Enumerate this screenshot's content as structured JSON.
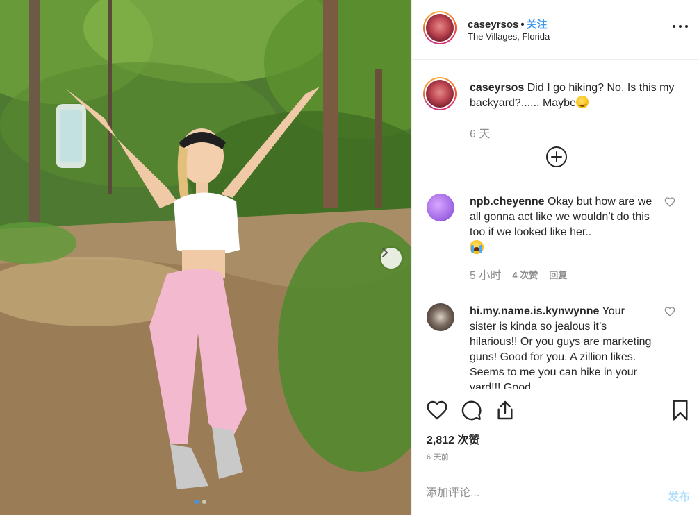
{
  "post": {
    "username": "caseyrsos",
    "follow_label": "关注",
    "location": "The Villages, Florida",
    "caption": {
      "username": "caseyrsos",
      "text": "Did I go hiking? No. Is this my backyard?...... Maybe",
      "emoji": "smiling-face-emoji",
      "time": "6 天"
    },
    "comments": [
      {
        "username": "npb.cheyenne",
        "text": "Okay but how are we all gonna act like we wouldn’t do this too if we looked like her..",
        "emoji": "loudly-crying-face-emoji",
        "time": "5 小时",
        "likes": "4 次赞",
        "reply": "回复"
      },
      {
        "username": "hi.my.name.is.kynwynne",
        "text": "Your sister is kinda so jealous it’s hilarious!! Or you guys are marketing guns! Good for you. A zillion likes. Seems to me you can hike in your yard!!! Good",
        "time": "",
        "likes": "",
        "reply": ""
      }
    ],
    "likes": "2,812 次赞",
    "date": "6 天前",
    "comment_placeholder": "添加评论...",
    "post_label": "发布",
    "carousel": {
      "slide_count": 2,
      "active_slide": 1
    }
  },
  "icons": {
    "more": "more-options-icon",
    "load_more": "plus-circle-icon",
    "like": "heart-icon",
    "comment": "comment-bubble-icon",
    "share": "share-icon",
    "save": "bookmark-icon",
    "next": "chevron-right-icon"
  },
  "colors": {
    "accent": "#3897f0",
    "text": "#262626",
    "muted": "#8e8e8e",
    "post_disabled": "#b2dffc",
    "border": "#efefef"
  }
}
